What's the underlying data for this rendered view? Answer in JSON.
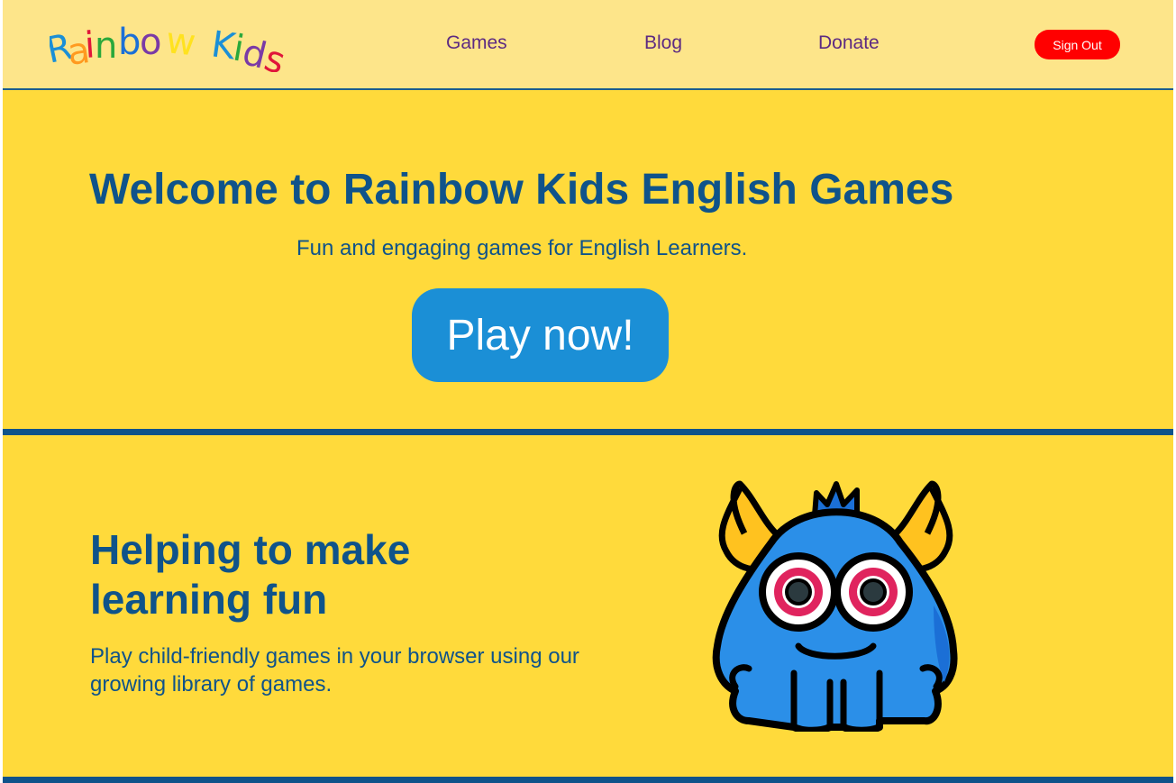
{
  "header": {
    "logo": {
      "letters": [
        {
          "char": "R",
          "color": "#1b8fd6"
        },
        {
          "char": "a",
          "color": "#ff9a1f"
        },
        {
          "char": "i",
          "color": "#e0163a"
        },
        {
          "char": "n",
          "color": "#2aa83b"
        },
        {
          "char": "b",
          "color": "#1b6fd6"
        },
        {
          "char": "o",
          "color": "#7a3aa6"
        },
        {
          "char": "w",
          "color": "#ffe21f"
        },
        {
          "char": "K",
          "color": "#1b8fd6"
        },
        {
          "char": "i",
          "color": "#2aa83b"
        },
        {
          "char": "d",
          "color": "#7a3aa6"
        },
        {
          "char": "s",
          "color": "#e0163a"
        }
      ]
    },
    "nav": {
      "games": "Games",
      "blog": "Blog",
      "donate": "Donate"
    },
    "sign_out_label": "Sign Out"
  },
  "hero": {
    "title": "Welcome to Rainbow Kids English Games",
    "subtitle": "Fun and engaging games for English Learners.",
    "cta_label": "Play now!"
  },
  "feature": {
    "title": "Helping to make learning fun",
    "text": "Play child-friendly games in your browser using our growing library of games.",
    "image_icon": "blue-monster-mascot-icon"
  },
  "colors": {
    "background": "#ffda3b",
    "header_background": "#fde58a",
    "heading": "#0f538a",
    "nav_text": "#5c2a82",
    "cta": "#1b8fd6",
    "sign_out": "#ff0000",
    "divider": "#0f538a"
  }
}
